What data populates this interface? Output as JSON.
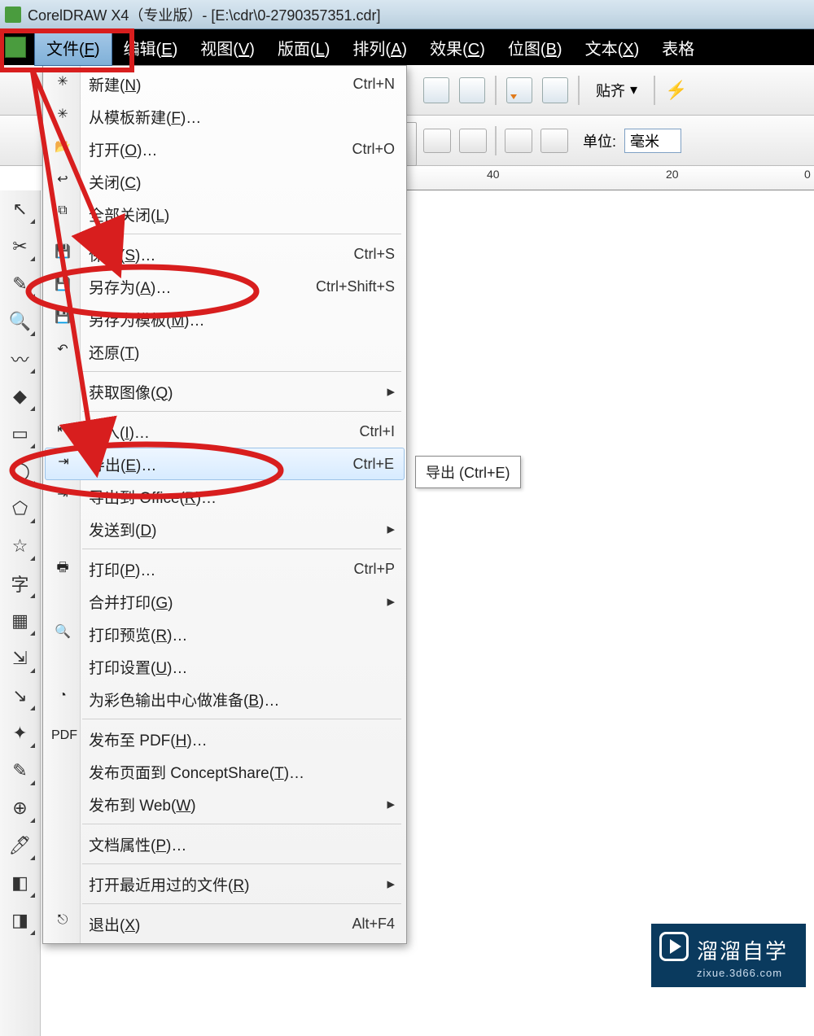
{
  "title": "CorelDRAW X4（专业版）- [E:\\cdr\\0-2790357351.cdr]",
  "menubar": [
    "文件(F)",
    "编辑(E)",
    "视图(V)",
    "版面(L)",
    "排列(A)",
    "效果(C)",
    "位图(B)",
    "文本(X)",
    "表格"
  ],
  "toolbar2": {
    "snap_label": "贴齐",
    "unit_label": "单位:",
    "unit_value": "毫米"
  },
  "ruler": {
    "t40": "40",
    "t20": "20",
    "t0": "0"
  },
  "tooltip": "导出 (Ctrl+E)",
  "file_menu": [
    {
      "kind": "item",
      "icon": "new-icon",
      "label": "新建(<u>N</u>)",
      "shortcut": "Ctrl+N"
    },
    {
      "kind": "item",
      "icon": "new-template-icon",
      "label": "从模板新建(<u>F</u>)…",
      "shortcut": ""
    },
    {
      "kind": "item",
      "icon": "open-icon",
      "label": "打开(<u>O</u>)…",
      "shortcut": "Ctrl+O"
    },
    {
      "kind": "item",
      "icon": "close-icon",
      "label": "关闭(<u>C</u>)",
      "shortcut": ""
    },
    {
      "kind": "item",
      "icon": "close-all-icon",
      "label": "全部关闭(<u>L</u>)",
      "shortcut": ""
    },
    {
      "kind": "sep"
    },
    {
      "kind": "item",
      "icon": "save-icon",
      "label": "保存(<u>S</u>)…",
      "shortcut": "Ctrl+S"
    },
    {
      "kind": "item",
      "icon": "save-as-icon",
      "label": "另存为(<u>A</u>)…",
      "shortcut": "Ctrl+Shift+S"
    },
    {
      "kind": "item",
      "icon": "save-template-icon",
      "label": "另存为模板(<u>M</u>)…",
      "shortcut": ""
    },
    {
      "kind": "item",
      "icon": "revert-icon",
      "label": "还原(<u>T</u>)",
      "shortcut": ""
    },
    {
      "kind": "sep"
    },
    {
      "kind": "item",
      "icon": "acquire-icon",
      "label": "获取图像(<u>Q</u>)",
      "shortcut": "",
      "submenu": true
    },
    {
      "kind": "sep"
    },
    {
      "kind": "item",
      "icon": "import-icon",
      "label": "导入(<u>I</u>)…",
      "shortcut": "Ctrl+I"
    },
    {
      "kind": "item",
      "icon": "export-icon",
      "label": "导出(<u>E</u>)…",
      "shortcut": "Ctrl+E",
      "highlight": true
    },
    {
      "kind": "item",
      "icon": "export-office-icon",
      "label": "导出到 Office(<u>R</u>)…",
      "shortcut": ""
    },
    {
      "kind": "item",
      "icon": "",
      "label": "发送到(<u>D</u>)",
      "shortcut": "",
      "submenu": true
    },
    {
      "kind": "sep"
    },
    {
      "kind": "item",
      "icon": "print-icon",
      "label": "打印(<u>P</u>)…",
      "shortcut": "Ctrl+P"
    },
    {
      "kind": "item",
      "icon": "",
      "label": "合并打印(<u>G</u>)",
      "shortcut": "",
      "submenu": true
    },
    {
      "kind": "item",
      "icon": "print-preview-icon",
      "label": "打印预览(<u>R</u>)…",
      "shortcut": ""
    },
    {
      "kind": "item",
      "icon": "",
      "label": "打印设置(<u>U</u>)…",
      "shortcut": ""
    },
    {
      "kind": "item",
      "icon": "color-prep-icon",
      "label": "为彩色输出中心做准备(<u>B</u>)…",
      "shortcut": ""
    },
    {
      "kind": "sep"
    },
    {
      "kind": "item",
      "icon": "pdf-icon",
      "label": "发布至 PDF(<u>H</u>)…",
      "shortcut": ""
    },
    {
      "kind": "item",
      "icon": "",
      "label": "发布页面到 ConceptShare(<u>T</u>)…",
      "shortcut": ""
    },
    {
      "kind": "item",
      "icon": "",
      "label": "发布到 Web(<u>W</u>)",
      "shortcut": "",
      "submenu": true
    },
    {
      "kind": "sep"
    },
    {
      "kind": "item",
      "icon": "",
      "label": "文档属性(<u>P</u>)…",
      "shortcut": ""
    },
    {
      "kind": "sep"
    },
    {
      "kind": "item",
      "icon": "",
      "label": "打开最近用过的文件(<u>R</u>)",
      "shortcut": "",
      "submenu": true
    },
    {
      "kind": "sep"
    },
    {
      "kind": "item",
      "icon": "exit-icon",
      "label": "退出(<u>X</u>)",
      "shortcut": "Alt+F4"
    }
  ],
  "toolbox": [
    "pick-tool",
    "shape-tool",
    "crop-tool",
    "zoom-tool",
    "freehand-tool",
    "smart-fill-tool",
    "rectangle-tool",
    "ellipse-tool",
    "polygon-tool",
    "basic-shapes-tool",
    "text-tool",
    "table-tool",
    "dimension-tool",
    "connector-tool",
    "interactive-tool",
    "eyedropper-tool",
    "outline-tool",
    "fill-tool",
    "interactive-fill-tool",
    "mesh-tool"
  ],
  "watermark": {
    "text": "溜溜自学",
    "sub": "zixue.3d66.com"
  }
}
